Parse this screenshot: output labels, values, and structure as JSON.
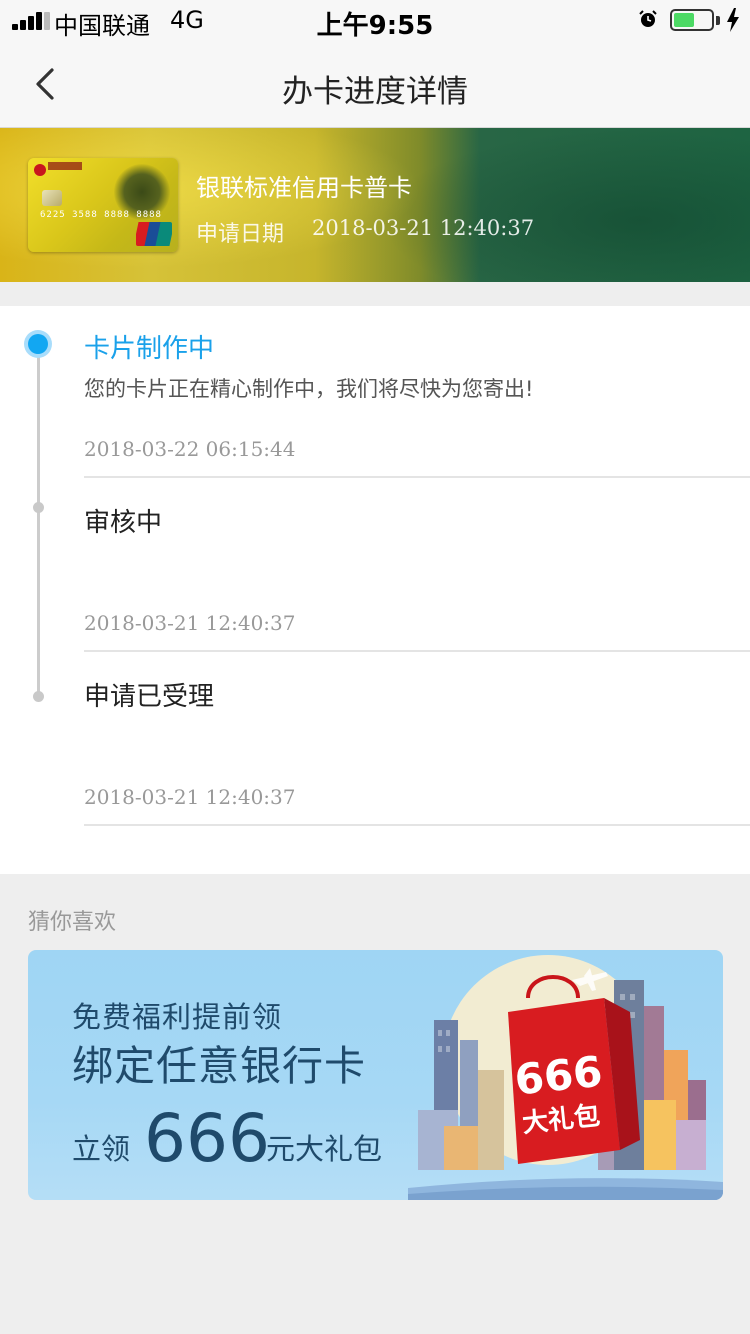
{
  "status_bar": {
    "carrier": "中国联通",
    "network": "4G",
    "time": "上午9:55"
  },
  "nav": {
    "title": "办卡进度详情"
  },
  "card": {
    "image_number": "6225  3588  8888  8888",
    "name": "银联标准信用卡普卡",
    "date_label": "申请日期",
    "date_value": "2018-03-21 12:40:37"
  },
  "timeline": [
    {
      "title": "卡片制作中",
      "desc": "您的卡片正在精心制作中，我们将尽快为您寄出!",
      "time": "2018-03-22 06:15:44",
      "active": true
    },
    {
      "title": "审核中",
      "desc": "",
      "time": "2018-03-21 12:40:37",
      "active": false
    },
    {
      "title": "申请已受理",
      "desc": "",
      "time": "2018-03-21 12:40:37",
      "active": false
    }
  ],
  "recommend": {
    "label": "猜你喜欢",
    "ad": {
      "line1": "免费福利提前领",
      "line2": "绑定任意银行卡",
      "prefix": "立领",
      "amount": "666",
      "suffix": "元大礼包",
      "bag_amount": "666",
      "bag_text": "大礼包"
    }
  },
  "colors": {
    "accent": "#1aa1ea",
    "battery": "#4cd964",
    "ad_text": "#1f4a6b",
    "gift_bag": "#d81c20"
  },
  "icons": [
    "signal-icon",
    "alarm-icon",
    "battery-icon",
    "charging-icon",
    "back-arrow-icon",
    "unionpay-logo-icon"
  ]
}
